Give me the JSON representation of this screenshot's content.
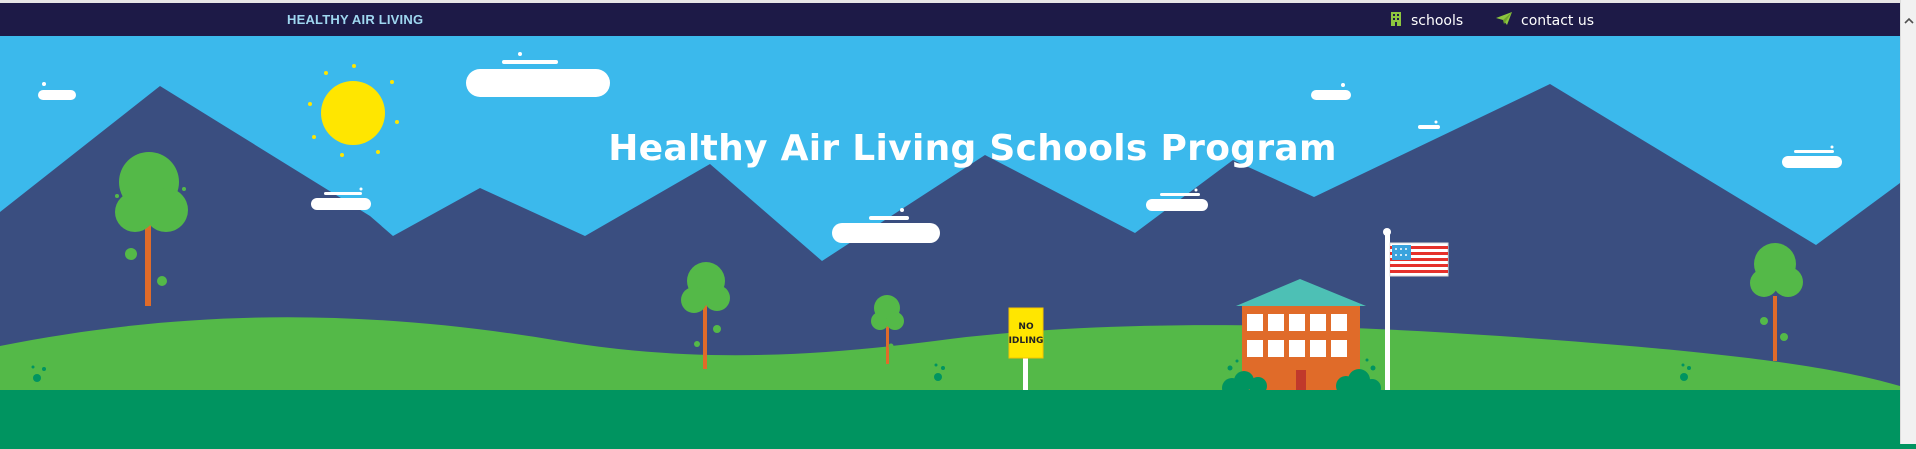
{
  "header": {
    "brand": "HEALTHY AIR LIVING",
    "nav": [
      {
        "label": "schools",
        "icon": "building-icon"
      },
      {
        "label": "contact us",
        "icon": "paper-plane-icon"
      }
    ]
  },
  "hero": {
    "title": "Healthy Air Living Schools Program",
    "sign_line1": "NO",
    "sign_line2": "IDLING"
  },
  "colors": {
    "header_bg": "#1d1a47",
    "brand_text": "#9fd7f0",
    "sky": "#3bb9ec",
    "mountains": "#3a4e80",
    "hill": "#54b948",
    "ground": "#009460",
    "icon_accent": "#8dc63f"
  }
}
